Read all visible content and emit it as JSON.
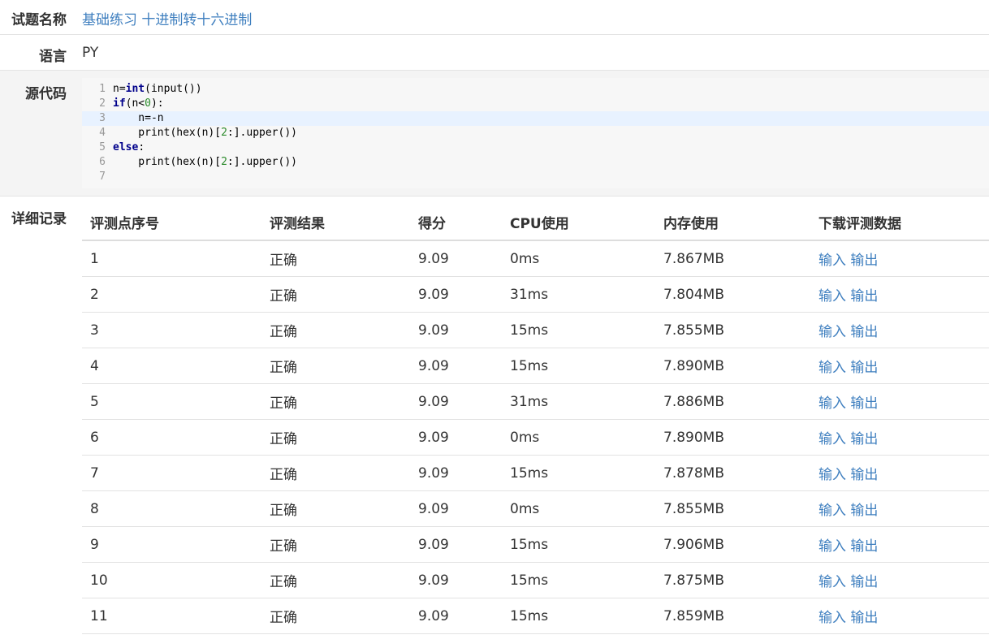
{
  "problem": {
    "label": "试题名称",
    "value": "基础练习 十进制转十六进制"
  },
  "language": {
    "label": "语言",
    "value": "PY"
  },
  "source": {
    "label": "源代码",
    "lines": [
      {
        "no": "1",
        "text": "n=int(input())"
      },
      {
        "no": "2",
        "text": "if(n<0):"
      },
      {
        "no": "3",
        "text": "    n=-n"
      },
      {
        "no": "4",
        "text": "    print(hex(n)[2:].upper())"
      },
      {
        "no": "5",
        "text": "else:"
      },
      {
        "no": "6",
        "text": "    print(hex(n)[2:].upper())"
      },
      {
        "no": "7",
        "text": ""
      }
    ],
    "highlighted_line": 3
  },
  "detail": {
    "label": "详细记录",
    "headers": [
      "评测点序号",
      "评测结果",
      "得分",
      "CPU使用",
      "内存使用",
      "下载评测数据"
    ],
    "download_input": "输入",
    "download_output": "输出",
    "rows": [
      {
        "id": "1",
        "result": "正确",
        "score": "9.09",
        "cpu": "0ms",
        "mem": "7.867MB"
      },
      {
        "id": "2",
        "result": "正确",
        "score": "9.09",
        "cpu": "31ms",
        "mem": "7.804MB"
      },
      {
        "id": "3",
        "result": "正确",
        "score": "9.09",
        "cpu": "15ms",
        "mem": "7.855MB"
      },
      {
        "id": "4",
        "result": "正确",
        "score": "9.09",
        "cpu": "15ms",
        "mem": "7.890MB"
      },
      {
        "id": "5",
        "result": "正确",
        "score": "9.09",
        "cpu": "31ms",
        "mem": "7.886MB"
      },
      {
        "id": "6",
        "result": "正确",
        "score": "9.09",
        "cpu": "0ms",
        "mem": "7.890MB"
      },
      {
        "id": "7",
        "result": "正确",
        "score": "9.09",
        "cpu": "15ms",
        "mem": "7.878MB"
      },
      {
        "id": "8",
        "result": "正确",
        "score": "9.09",
        "cpu": "0ms",
        "mem": "7.855MB"
      },
      {
        "id": "9",
        "result": "正确",
        "score": "9.09",
        "cpu": "15ms",
        "mem": "7.906MB"
      },
      {
        "id": "10",
        "result": "正确",
        "score": "9.09",
        "cpu": "15ms",
        "mem": "7.875MB"
      },
      {
        "id": "11",
        "result": "正确",
        "score": "9.09",
        "cpu": "15ms",
        "mem": "7.859MB"
      }
    ]
  },
  "colors": {
    "link": "#3f7fbf",
    "code_keyword": "#00008b",
    "code_number": "#2a8a2a",
    "active_line": "#e8f2ff"
  }
}
